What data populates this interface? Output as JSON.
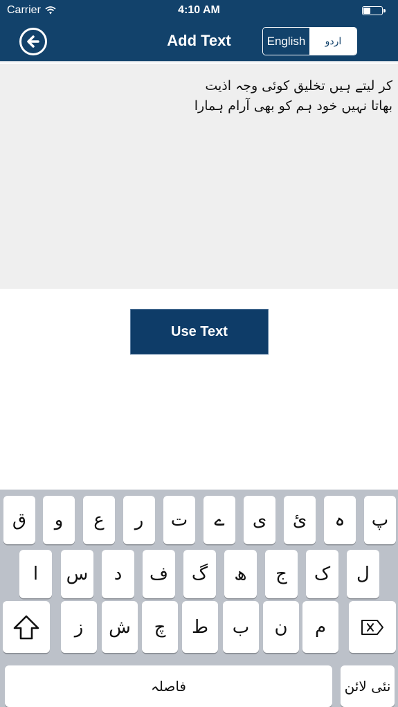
{
  "status_bar": {
    "carrier": "Carrier",
    "time": "4:10 AM",
    "battery_level": 0.35
  },
  "header": {
    "title": "Add Text",
    "back_icon": "back-arrow-circle-icon",
    "language_toggle": {
      "options": [
        "English",
        "اردو"
      ],
      "selected": "English"
    }
  },
  "editor": {
    "lines": [
      "کر لیتے ہیں تخلیق کوئی وجہ اذیت",
      "بھاتا نہیں خود ہم کو بھی آرام ہمارا"
    ]
  },
  "use_button_label": "Use Text",
  "keyboard": {
    "row1": [
      "ق",
      "و",
      "ع",
      "ر",
      "ت",
      "ے",
      "ی",
      "ئ",
      "ہ",
      "پ"
    ],
    "row2": [
      "ا",
      "س",
      "د",
      "ف",
      "گ",
      "ھ",
      "ج",
      "ک",
      "ل"
    ],
    "row3": [
      "ز",
      "ش",
      "چ",
      "ط",
      "ب",
      "ن",
      "م"
    ],
    "shift_icon": "shift-arrow-icon",
    "delete_icon": "backspace-icon",
    "space_label": "فاصلہ",
    "return_label": "نئی لائن"
  },
  "colors": {
    "brand": "#12426b",
    "button": "#0e3c68",
    "editor_bg": "#efefef",
    "keyboard_bg": "#bcc1c9"
  }
}
